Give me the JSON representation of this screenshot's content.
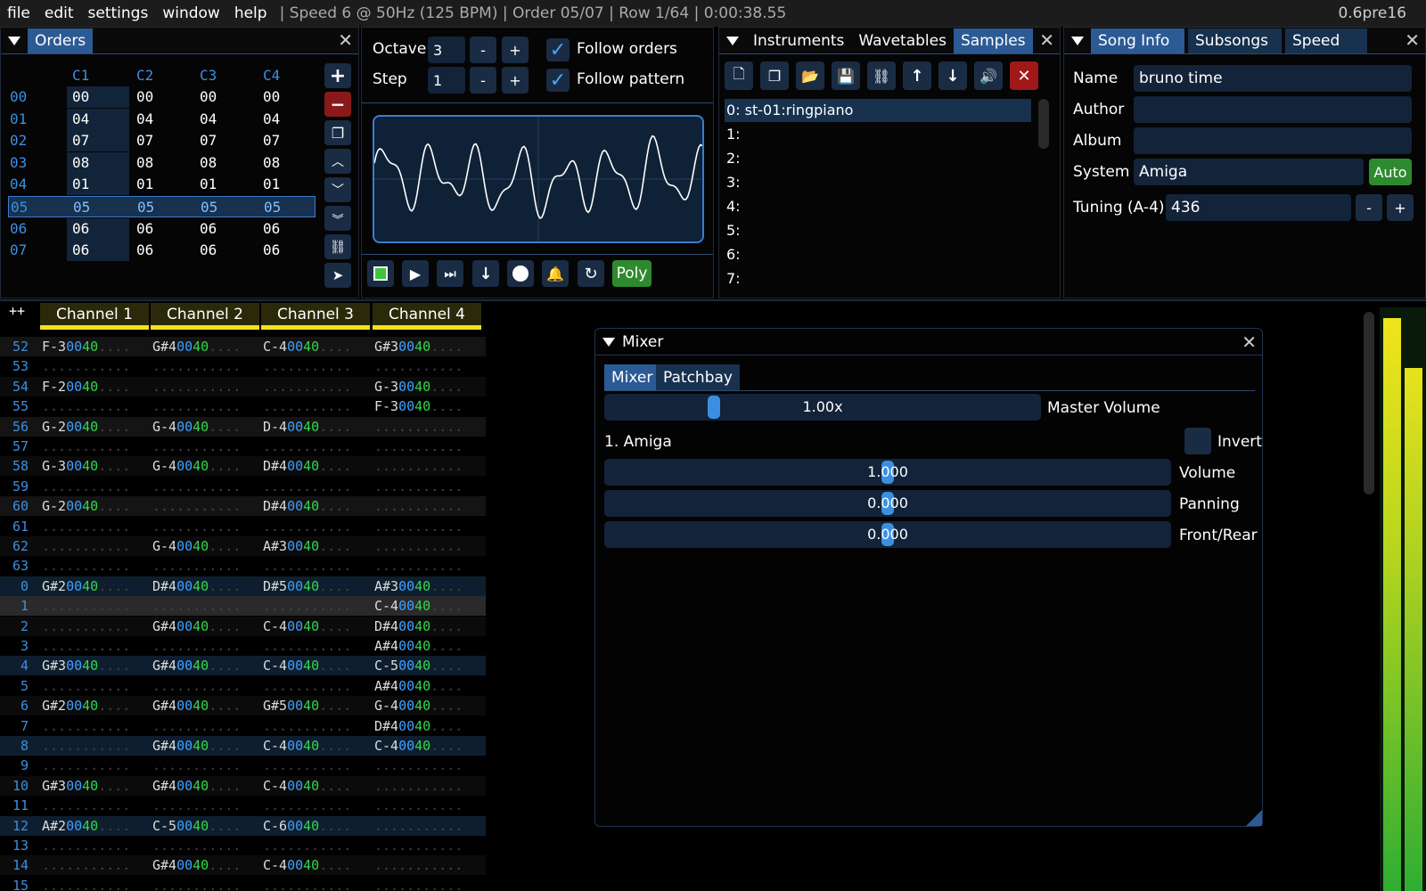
{
  "menubar": {
    "items": [
      "file",
      "edit",
      "settings",
      "window",
      "help"
    ],
    "status": "| Speed 6 @ 50Hz (125 BPM) | Order 05/07 | Row 1/64 | 0:00:38.55",
    "version": "0.6pre16"
  },
  "orders": {
    "title": "Orders",
    "columns": [
      "C1",
      "C2",
      "C3",
      "C4"
    ],
    "rows": [
      {
        "num": "00",
        "cells": [
          "00",
          "00",
          "00",
          "00"
        ]
      },
      {
        "num": "01",
        "cells": [
          "04",
          "04",
          "04",
          "04"
        ]
      },
      {
        "num": "02",
        "cells": [
          "07",
          "07",
          "07",
          "07"
        ]
      },
      {
        "num": "03",
        "cells": [
          "08",
          "08",
          "08",
          "08"
        ]
      },
      {
        "num": "04",
        "cells": [
          "01",
          "01",
          "01",
          "01"
        ]
      },
      {
        "num": "05",
        "cells": [
          "05",
          "05",
          "05",
          "05"
        ]
      },
      {
        "num": "06",
        "cells": [
          "06",
          "06",
          "06",
          "06"
        ]
      },
      {
        "num": "07",
        "cells": [
          "06",
          "06",
          "06",
          "06"
        ]
      }
    ],
    "selected_row": 5
  },
  "controls": {
    "octave_label": "Octave",
    "octave_value": "3",
    "step_label": "Step",
    "step_value": "1",
    "minus": "-",
    "plus": "+",
    "follow_orders": "Follow orders",
    "follow_pattern": "Follow pattern",
    "poly": "Poly"
  },
  "samples": {
    "tabs": [
      "Instruments",
      "Wavetables",
      "Samples"
    ],
    "active_tab": "Samples",
    "items": [
      "0: st-01:ringpiano",
      "1:",
      "2:",
      "3:",
      "4:",
      "5:",
      "6:",
      "7:"
    ]
  },
  "songinfo": {
    "tabs": [
      "Song Info",
      "Subsongs",
      "Speed"
    ],
    "name_label": "Name",
    "name_value": "bruno time",
    "author_label": "Author",
    "author_value": "",
    "album_label": "Album",
    "album_value": "",
    "system_label": "System",
    "system_value": "Amiga",
    "auto_label": "Auto",
    "tuning_label": "Tuning (A-4)",
    "tuning_value": "436"
  },
  "pattern": {
    "corner": "++",
    "channels": [
      "Channel  1",
      "Channel  2",
      "Channel  3",
      "Channel  4"
    ],
    "rows": [
      {
        "n": "52",
        "c": [
          "F-30040....",
          "G#40040....",
          "C-40040....",
          "G#30040...."
        ]
      },
      {
        "n": "53",
        "c": [
          "...........",
          "...........",
          "...........",
          "..........."
        ]
      },
      {
        "n": "54",
        "c": [
          "F-20040....",
          "...........",
          "...........",
          "G-30040...."
        ]
      },
      {
        "n": "55",
        "c": [
          "...........",
          "...........",
          "...........",
          "F-30040...."
        ]
      },
      {
        "n": "56",
        "c": [
          "G-20040....",
          "G-40040....",
          "D-40040....",
          "..........."
        ]
      },
      {
        "n": "57",
        "c": [
          "...........",
          "...........",
          "...........",
          "..........."
        ]
      },
      {
        "n": "58",
        "c": [
          "G-30040....",
          "G-40040....",
          "D#40040....",
          "..........."
        ]
      },
      {
        "n": "59",
        "c": [
          "...........",
          "...........",
          "...........",
          "..........."
        ]
      },
      {
        "n": "60",
        "c": [
          "G-20040....",
          "...........",
          "D#40040....",
          "..........."
        ]
      },
      {
        "n": "61",
        "c": [
          "...........",
          "...........",
          "...........",
          "..........."
        ]
      },
      {
        "n": "62",
        "c": [
          "...........",
          "G-40040....",
          "A#30040....",
          "..........."
        ]
      },
      {
        "n": "63",
        "c": [
          "...........",
          "...........",
          "...........",
          "..........."
        ]
      },
      {
        "n": "0",
        "c": [
          "G#20040....",
          "D#40040....",
          "D#50040....",
          "A#30040...."
        ]
      },
      {
        "n": "1",
        "c": [
          "...........",
          "...........",
          "...........",
          "C-40040...."
        ]
      },
      {
        "n": "2",
        "c": [
          "...........",
          "G#40040....",
          "C-40040....",
          "D#40040...."
        ]
      },
      {
        "n": "3",
        "c": [
          "...........",
          "...........",
          "...........",
          "A#40040...."
        ]
      },
      {
        "n": "4",
        "c": [
          "G#30040....",
          "G#40040....",
          "C-40040....",
          "C-50040...."
        ]
      },
      {
        "n": "5",
        "c": [
          "...........",
          "...........",
          "...........",
          "A#40040...."
        ]
      },
      {
        "n": "6",
        "c": [
          "G#20040....",
          "G#40040....",
          "G#50040....",
          "G-40040...."
        ]
      },
      {
        "n": "7",
        "c": [
          "...........",
          "...........",
          "...........",
          "D#40040...."
        ]
      },
      {
        "n": "8",
        "c": [
          "...........",
          "G#40040....",
          "C-40040....",
          "C-40040...."
        ]
      },
      {
        "n": "9",
        "c": [
          "...........",
          "...........",
          "...........",
          "..........."
        ]
      },
      {
        "n": "10",
        "c": [
          "G#30040....",
          "G#40040....",
          "C-40040....",
          "..........."
        ]
      },
      {
        "n": "11",
        "c": [
          "...........",
          "...........",
          "...........",
          "..........."
        ]
      },
      {
        "n": "12",
        "c": [
          "A#20040....",
          "C-50040....",
          "C-60040....",
          "..........."
        ]
      },
      {
        "n": "13",
        "c": [
          "...........",
          "...........",
          "...........",
          "..........."
        ]
      },
      {
        "n": "14",
        "c": [
          "...........",
          "G#40040....",
          "C-40040....",
          "..........."
        ]
      },
      {
        "n": "15",
        "c": [
          "...........",
          "...........",
          "...........",
          "..........."
        ]
      }
    ]
  },
  "mixer": {
    "title": "Mixer",
    "tabs": [
      "Mixer",
      "Patchbay"
    ],
    "master_value": "1.00x",
    "master_label": "Master Volume",
    "master_level": 0.25,
    "chip": "1. Amiga",
    "invert_label": "Invert",
    "volume_value": "1.000",
    "volume_label": "Volume",
    "panning_value": "0.000",
    "panning_label": "Panning",
    "frontrear_value": "0.000",
    "frontrear_label": "Front/Rear"
  },
  "colors": {
    "accent": "#3b8fe0",
    "note_volume": "#30d84a",
    "channel_header": "#f2e21c",
    "poly_button": "#2e8a2e"
  }
}
